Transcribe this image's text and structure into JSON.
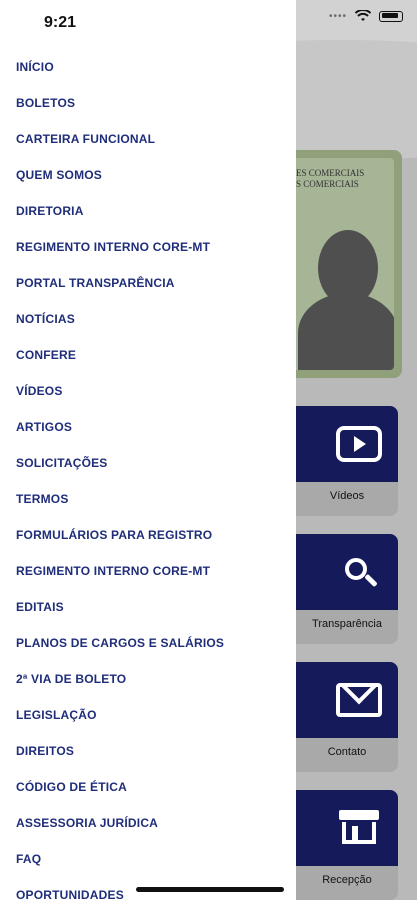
{
  "status_bar": {
    "time": "9:21"
  },
  "drawer": {
    "menu_items": [
      "INÍCIO",
      "BOLETOS",
      "CARTEIRA FUNCIONAL",
      "QUEM SOMOS",
      "DIRETORIA",
      "REGIMENTO INTERNO CORE-MT",
      "PORTAL TRANSPARÊNCIA",
      "NOTÍCIAS",
      "CONFERE",
      "VÍDEOS",
      "ARTIGOS",
      "SOLICITAÇÕES",
      "TERMOS",
      "FORMULÁRIOS PARA REGISTRO",
      "REGIMENTO INTERNO CORE-MT",
      "EDITAIS",
      "PLANOS DE CARGOS E SALÁRIOS",
      "2ª VIA DE BOLETO",
      "LEGISLAÇÃO",
      "DIREITOS",
      "CÓDIGO DE ÉTICA",
      "ASSESSORIA JURÍDICA",
      "FAQ",
      "OPORTUNIDADES"
    ]
  },
  "background": {
    "card_text_line1": "ES COMERCIAIS",
    "card_text_line2": "S COMERCIAIS",
    "tiles": [
      {
        "label": "Vídeos",
        "icon": "play-icon"
      },
      {
        "label": "Transparência",
        "icon": "search-icon"
      },
      {
        "label": "Contato",
        "icon": "mail-icon"
      },
      {
        "label": "Recepção",
        "icon": "store-icon"
      }
    ]
  },
  "colors": {
    "menu_text": "#1f2d7a",
    "tile_top": "#151a5a",
    "overlay": "#b9b9b9"
  }
}
